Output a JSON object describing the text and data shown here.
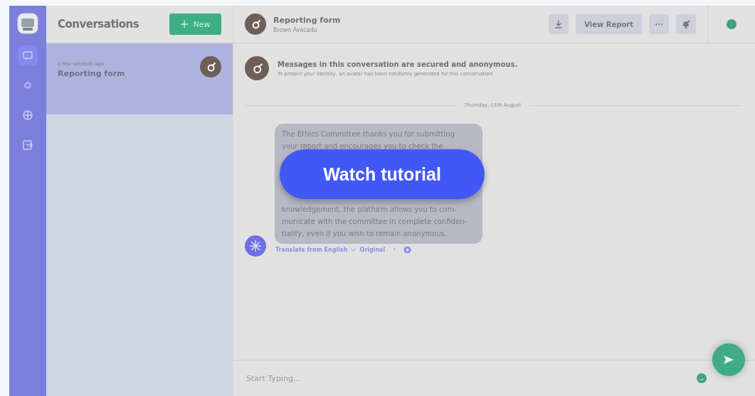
{
  "nav": {
    "items": [
      {
        "kind": "chat",
        "selected": true
      },
      {
        "kind": "gear",
        "selected": false
      },
      {
        "kind": "globe",
        "selected": false
      },
      {
        "kind": "exit",
        "selected": false
      }
    ]
  },
  "conversations": {
    "title": "Conversations",
    "new_button": "New",
    "items": [
      {
        "time": "a few seconds ago",
        "title": "Reporting form",
        "selected": true
      }
    ]
  },
  "chat_header": {
    "title": "Reporting form",
    "subtitle": "Brown Avocado",
    "view_report": "View Report",
    "more": "···",
    "online": true
  },
  "notice": {
    "title": "Messages in this conversation are secured and anonymous.",
    "text": "To protect your identity, an avatar has been randomly generated for this conversation"
  },
  "date_divider": "Thursday, 11th August",
  "message": {
    "lines_before": [
      "The Ethics Committee thanks you for submitting",
      "your report and encourages you to check the"
    ],
    "lines_after": [
      "knowledgement, the platform allows you to com-",
      "municate with the committee in complete confiden-",
      "tiality, even if you wish to remain anonymous."
    ],
    "translate": "Translate from English",
    "original": "Original",
    "separator": "•"
  },
  "composer": {
    "placeholder": "Start Typing..."
  },
  "overlay_button": "Watch tutorial"
}
